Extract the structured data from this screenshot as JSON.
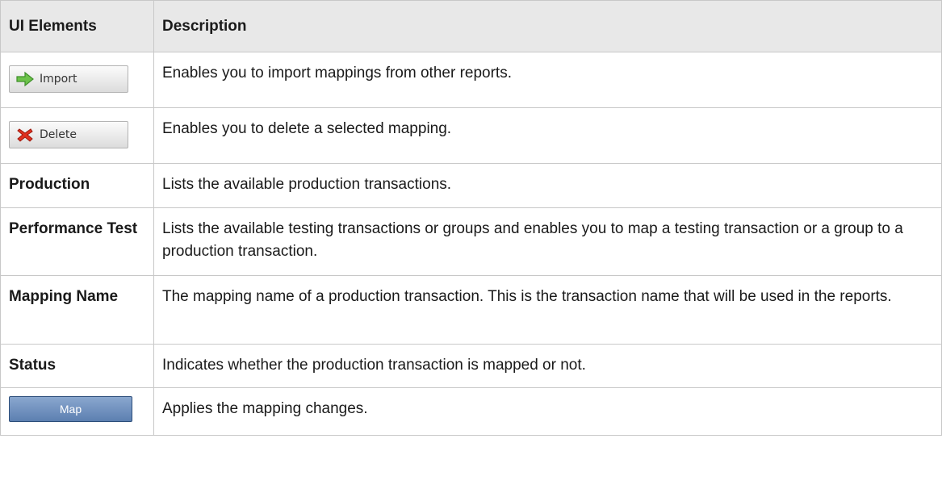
{
  "header": {
    "col_ui_elements": "UI Elements",
    "col_description": "Description"
  },
  "rows": [
    {
      "element": "Import",
      "icon": "green-arrow-right-icon",
      "description": "Enables you to import mappings from other reports."
    },
    {
      "element": "Delete",
      "icon": "red-x-icon",
      "description": "Enables you to delete a selected mapping."
    },
    {
      "element": "Production",
      "description": "Lists the available production transactions."
    },
    {
      "element": "Performance Test",
      "description": "Lists the available testing transactions or groups and enables you to map a testing transaction or a group to a production transaction."
    },
    {
      "element": "Mapping Name",
      "description": "The mapping name of a production transaction. This is the transaction name that will be used in the reports."
    },
    {
      "element": "Status",
      "description": "Indicates whether the production transaction is mapped or not."
    },
    {
      "element": "Map",
      "description": "Applies the mapping changes."
    }
  ],
  "colors": {
    "header_bg": "#e8e8e8",
    "border": "#c8c8c8",
    "map_button": "#6f8fbf",
    "import_icon": "#6cc24a",
    "delete_icon": "#e0301e"
  }
}
